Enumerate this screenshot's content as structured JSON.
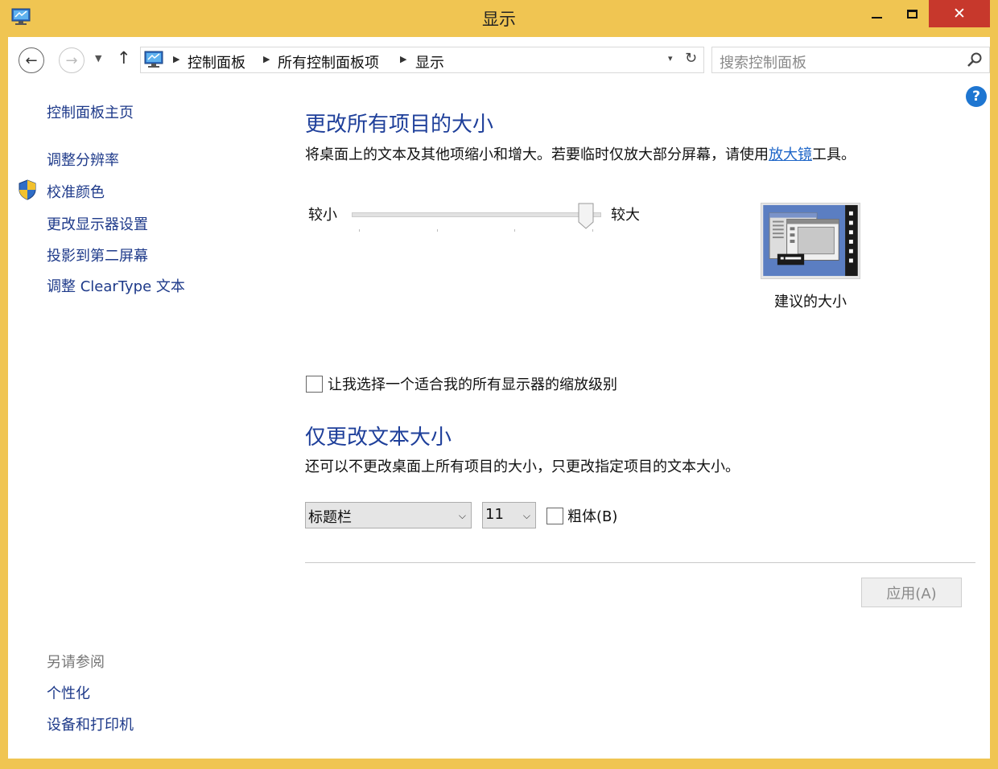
{
  "window": {
    "title": "显示",
    "close_glyph": "✕"
  },
  "nav": {
    "back_glyph": "←",
    "forward_glyph": "→",
    "recent_glyph": "▼",
    "up_glyph": "↑",
    "breadcrumbs": [
      "控制面板",
      "所有控制面板项",
      "显示"
    ],
    "separator_glyph": "▶",
    "dropdown_glyph": "▾",
    "refresh_glyph": "↻"
  },
  "search": {
    "placeholder": "搜索控制面板"
  },
  "help": {
    "glyph": "?"
  },
  "sidebar": {
    "home": "控制面板主页",
    "items": [
      "调整分辨率",
      "校准颜色",
      "更改显示器设置",
      "投影到第二屏幕",
      "调整 ClearType 文本"
    ],
    "see_also_heading": "另请参阅",
    "see_also": [
      "个性化",
      "设备和打印机"
    ]
  },
  "main": {
    "size_heading": "更改所有项目的大小",
    "size_desc_before": "将桌面上的文本及其他项缩小和增大。若要临时仅放大部分屏幕，请使用",
    "size_desc_link": "放大镜",
    "size_desc_after": "工具。",
    "slider": {
      "min_label": "较小",
      "max_label": "较大",
      "position_fraction": 0.97,
      "tick_count": 4
    },
    "preview_caption": "建议的大小",
    "custom_scale_checkbox": "让我选择一个适合我的所有显示器的缩放级别",
    "custom_scale_checked": false,
    "text_heading": "仅更改文本大小",
    "text_desc": "还可以不更改桌面上所有项目的大小，只更改指定项目的文本大小。",
    "item_select": "标题栏",
    "size_select": "11",
    "select_chevron": "⌵",
    "bold_label": "粗体(B)",
    "bold_checked": false,
    "apply_label": "应用(A)"
  },
  "colors": {
    "frame": "#f0c552",
    "close": "#c7382c",
    "heading": "#1e3f9a",
    "link": "#1e3a8a"
  }
}
